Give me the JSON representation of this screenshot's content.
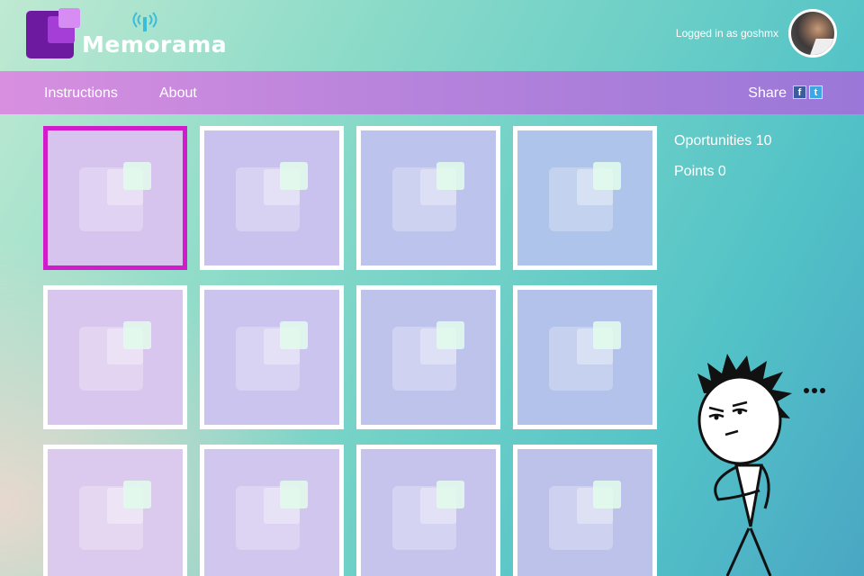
{
  "header": {
    "brand": "Memorama",
    "user_text": "Logged in as goshmx"
  },
  "nav": {
    "items": [
      {
        "label": "Instructions"
      },
      {
        "label": "About"
      }
    ],
    "share_label": "Share",
    "share_facebook_glyph": "f",
    "share_twitter_glyph": "t"
  },
  "board": {
    "rows": 3,
    "columns": 4,
    "selected_card": 0,
    "cards": [
      {
        "state": "face-down",
        "tint": "#d6c3ee"
      },
      {
        "state": "face-down",
        "tint": "#c9c2ee"
      },
      {
        "state": "face-down",
        "tint": "#bcc3ec"
      },
      {
        "state": "face-down",
        "tint": "#aec4ea"
      },
      {
        "state": "face-down",
        "tint": "#d9c6ee"
      },
      {
        "state": "face-down",
        "tint": "#cbc4ee"
      },
      {
        "state": "face-down",
        "tint": "#bec3ec"
      },
      {
        "state": "face-down",
        "tint": "#b3c2ea"
      },
      {
        "state": "face-down",
        "tint": "#dccaee"
      },
      {
        "state": "face-down",
        "tint": "#d0c6ee"
      },
      {
        "state": "face-down",
        "tint": "#c6c4ec"
      },
      {
        "state": "face-down",
        "tint": "#bdc2ea"
      }
    ]
  },
  "score": {
    "opportunities_text": "Oportunities 10",
    "points_text": "Points 0"
  },
  "colors": {
    "nav_start": "#d88fe0",
    "nav_end": "#9a77d8",
    "selected_border": "#d21ccc",
    "logo_purple": "#6e1aa0"
  },
  "icons": {
    "logo": "stacked-squares-logo",
    "signal": "wireless-signal-icon",
    "card_face": "stacked-squares-icon"
  }
}
